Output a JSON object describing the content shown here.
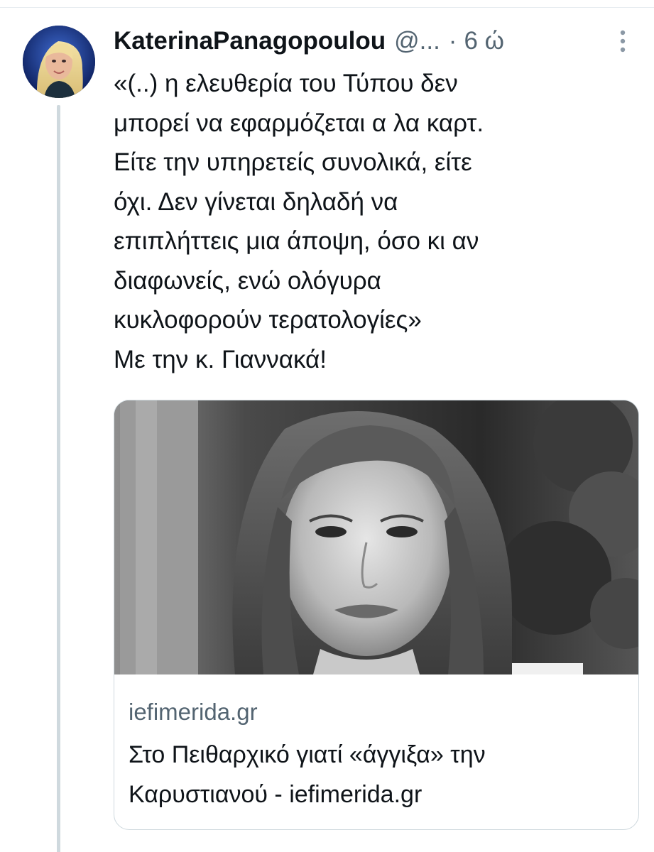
{
  "tweet": {
    "display_name": "KaterinaPanagopoulou",
    "handle": "@...",
    "separator": "·",
    "time": "6 ώ",
    "more_icon": "more-vertical-icon",
    "text_lines": [
      "«(..) η ελευθερία του Τύπου δεν",
      "μπορεί να εφαρμόζεται α λα καρτ.",
      "Είτε την υπηρετείς συνολικά, είτε",
      "όχι. Δεν γίνεται δηλαδή να",
      "επιπλήττεις μια άποψη, όσο κι αν",
      "διαφωνείς, ενώ ολόγυρα",
      "κυκλοφορούν τερατολογίες»",
      "Με την κ. Γιαννακά!"
    ]
  },
  "card": {
    "domain": "iefimerida.gr",
    "title_lines": [
      "Στο Πειθαρχικό γιατί «άγγιξα» την",
      "Καρυστιανού - iefimerida.gr"
    ]
  },
  "colors": {
    "text_primary": "#0f1419",
    "text_secondary": "#536471",
    "border": "#cfd9de"
  }
}
